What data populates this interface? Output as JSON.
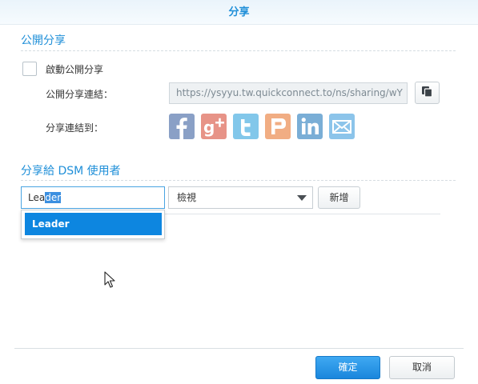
{
  "window": {
    "title": "分享"
  },
  "public_share": {
    "section_title": "公開分享",
    "enable_label": "啟動公開分享",
    "enabled": false,
    "link_label": "公開分享連結：",
    "link_value": "https://ysyyu.tw.quickconnect.to/ns/sharing/wY",
    "copy_icon": "copy-icon",
    "share_to_label": "分享連結到：",
    "social": [
      {
        "name": "facebook",
        "color": "#3b5998"
      },
      {
        "name": "google-plus",
        "color": "#dd4b39"
      },
      {
        "name": "twitter",
        "color": "#2aa9e0"
      },
      {
        "name": "plurk",
        "color": "#e86a1c"
      },
      {
        "name": "linkedin",
        "color": "#1a78b6"
      },
      {
        "name": "email",
        "color": "#3a9ad9"
      }
    ]
  },
  "dsm_share": {
    "section_title": "分享給 DSM 使用者",
    "user_input_typed": "Lea",
    "user_input_autocomplete": "der",
    "permission_value": "檢視",
    "add_label": "新增",
    "suggestions": [
      "Leader"
    ]
  },
  "footer": {
    "ok_label": "確定",
    "cancel_label": "取消"
  },
  "colors": {
    "accent": "#1f8fd8",
    "primary_button": "#1a86dc"
  }
}
